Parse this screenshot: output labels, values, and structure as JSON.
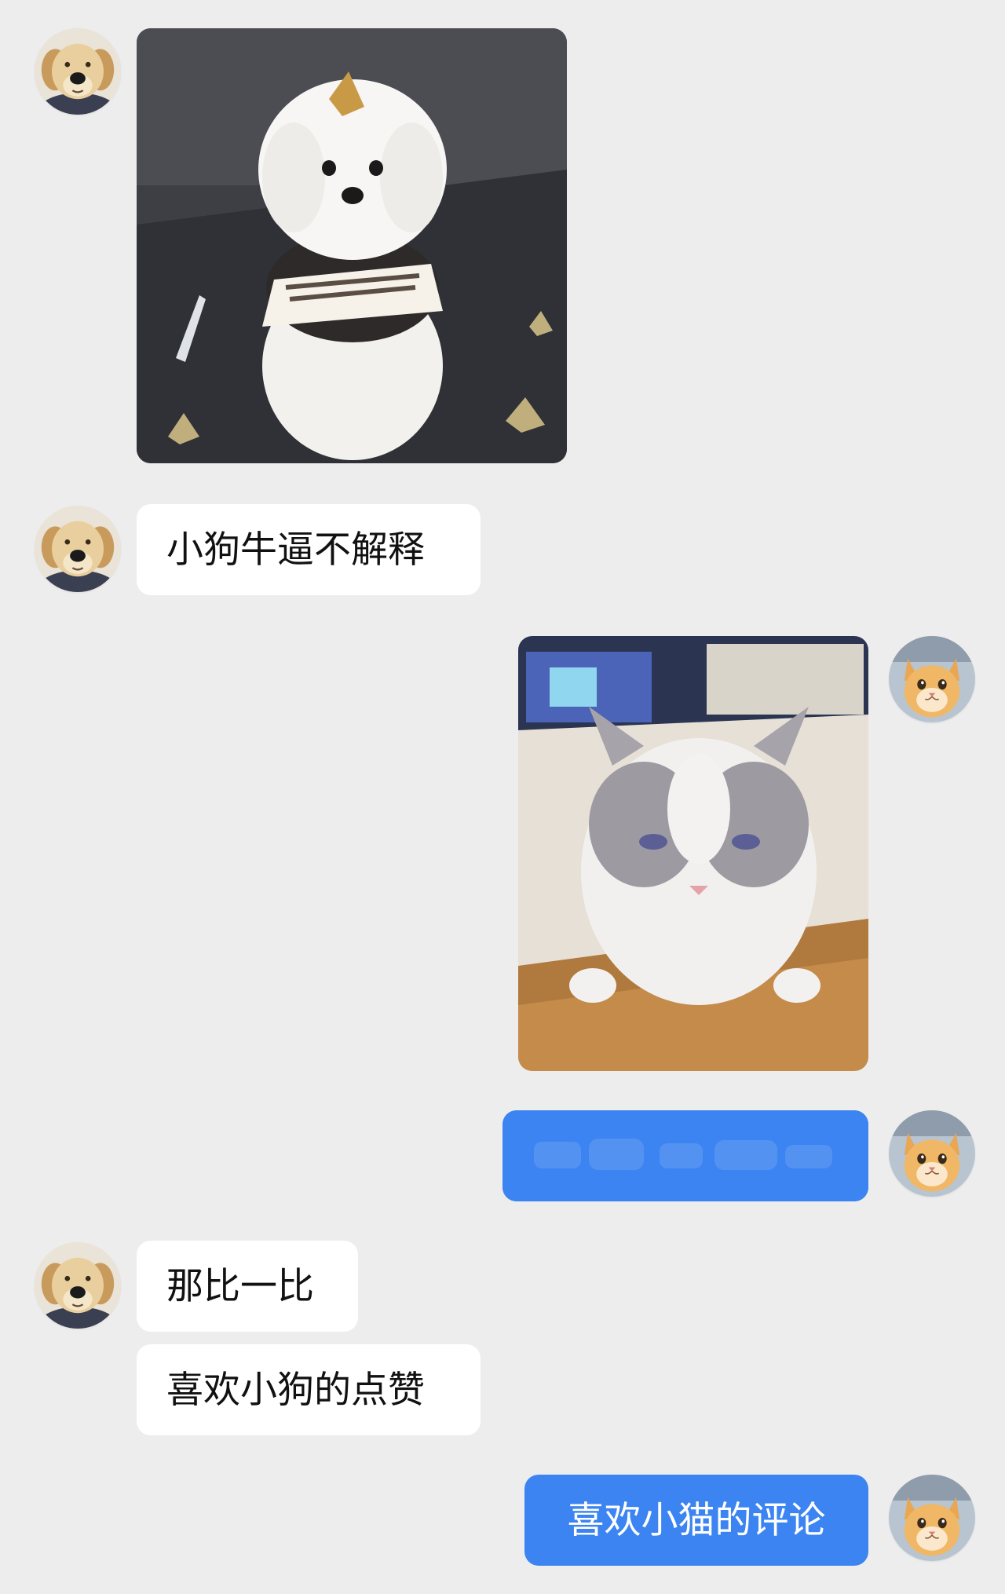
{
  "colors": {
    "background": "#ededed",
    "incoming_bubble": "#ffffff",
    "outgoing_bubble": "#3b84f1",
    "outgoing_text": "#ffffff"
  },
  "messages": [
    {
      "sender": "dog-user",
      "type": "image",
      "icon": "dog-photo"
    },
    {
      "sender": "dog-user",
      "type": "text",
      "text": "小狗牛逼不解释"
    },
    {
      "sender": "cat-user",
      "type": "image",
      "icon": "cat-photo"
    },
    {
      "sender": "cat-user",
      "type": "text",
      "text": ""
    },
    {
      "sender": "dog-user",
      "type": "text",
      "text": "那比一比"
    },
    {
      "sender": "dog-user",
      "type": "text",
      "text": "喜欢小狗的点赞"
    },
    {
      "sender": "cat-user",
      "type": "text",
      "text": "喜欢小猫的评论"
    }
  ],
  "avatars": {
    "dog_user": "golden-retriever-puppy-avatar",
    "cat_user": "orange-cat-avatar"
  }
}
